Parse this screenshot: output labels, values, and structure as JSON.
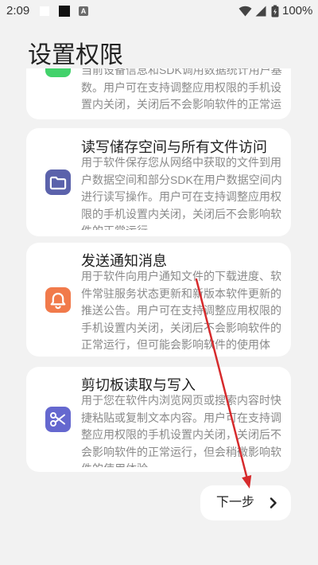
{
  "status_bar": {
    "time": "2:09",
    "left_icons": [
      "white-square-icon",
      "black-square-icon",
      "a-letter-icon"
    ],
    "a_icon_text": "A",
    "right_icons": [
      "wifi-icon",
      "signal-icon",
      "battery-icon"
    ],
    "battery_text": "100%"
  },
  "header": {
    "title": "设置权限"
  },
  "permissions": [
    {
      "icon": "green-app-icon",
      "icon_color": "#42d26b",
      "description_lines": [
        "当前设备信息和SDK调用数据统计用户基",
        "数。用户可在支持调整应用权限的手机设",
        "置内关闭，关闭后不会影响软件的正常运"
      ]
    },
    {
      "title": "读写储存空间与所有文件访问",
      "icon": "folder-icon",
      "icon_color": "#5b62ab",
      "description_lines": [
        "用于软件保存您从网络中获取的文件到用",
        "户数据空间和部分SDK在用户数据空间内",
        "进行读写操作。用户可在支持调整应用权",
        "限的手机设置内关闭，关闭后不会影响软",
        "件的正常运行"
      ]
    },
    {
      "title": "发送通知消息",
      "icon": "bell-icon",
      "icon_color": "#f17a4b",
      "description_lines": [
        "用于软件向用户通知文件的下载进度、软",
        "件常驻服务状态更新和新版本软件更新的",
        "推送公告。用户可在支持调整应用权限的",
        "手机设置内关闭，关闭后不会影响软件的",
        "正常运行，但可能会影响软件的使用体"
      ]
    },
    {
      "title": "剪切板读取与写入",
      "icon": "scissors-icon",
      "icon_color": "#6568cf",
      "description_lines": [
        "用于您在软件内浏览网页或搜索内容时快",
        "捷粘贴或复制文本内容。用户可在支持调",
        "整应用权限的手机设置内关闭，关闭后不",
        "会影响软件的正常运行，但会稍微影响软",
        "件的使用体验"
      ]
    }
  ],
  "footer": {
    "next_label": "下一步",
    "next_icon": "chevron-right-icon"
  },
  "annotation": {
    "color": "#d62a2c"
  },
  "colors": {
    "background": "#f2f2f2",
    "card": "#ffffff",
    "title_text": "#1f1f1f",
    "body_text": "#8a8a8a"
  }
}
